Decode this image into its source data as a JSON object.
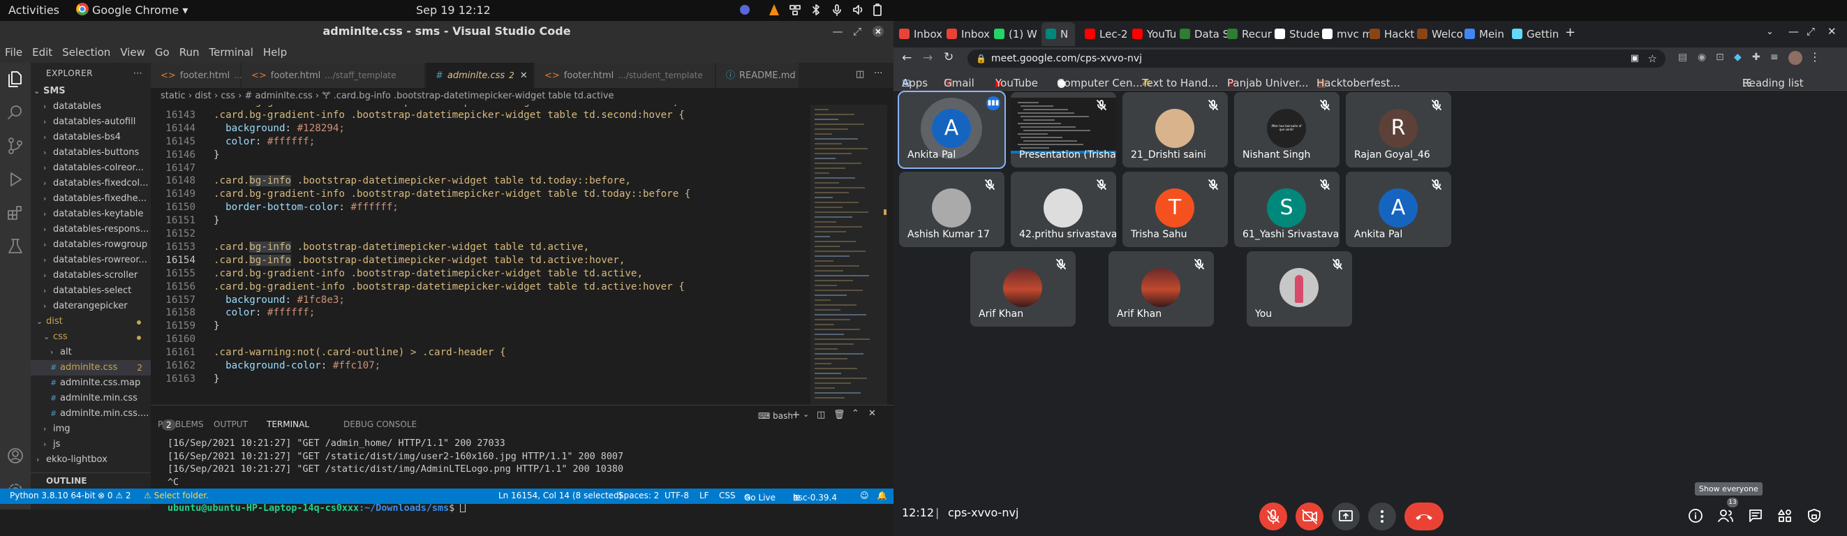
{
  "system": {
    "activities": "Activities",
    "app_menu": "Google Chrome ▾",
    "datetime": "Sep 19  12:12"
  },
  "vscode": {
    "title": "adminlte.css - sms - Visual Studio Code",
    "menu": [
      "File",
      "Edit",
      "Selection",
      "View",
      "Go",
      "Run",
      "Terminal",
      "Help"
    ],
    "explorer_header": "EXPLORER",
    "explorer_more": "···",
    "root": "SMS",
    "tree": [
      {
        "t": "datatables",
        "k": "folder",
        "d": 1
      },
      {
        "t": "datatables-autofill",
        "k": "folder",
        "d": 1
      },
      {
        "t": "datatables-bs4",
        "k": "folder",
        "d": 1
      },
      {
        "t": "datatables-buttons",
        "k": "folder",
        "d": 1
      },
      {
        "t": "datatables-colreor...",
        "k": "folder",
        "d": 1
      },
      {
        "t": "datatables-fixedcol...",
        "k": "folder",
        "d": 1
      },
      {
        "t": "datatables-fixedhe...",
        "k": "folder",
        "d": 1
      },
      {
        "t": "datatables-keytable",
        "k": "folder",
        "d": 1
      },
      {
        "t": "datatables-respons...",
        "k": "folder",
        "d": 1
      },
      {
        "t": "datatables-rowgroup",
        "k": "folder",
        "d": 1
      },
      {
        "t": "datatables-rowreor...",
        "k": "folder",
        "d": 1
      },
      {
        "t": "datatables-scroller",
        "k": "folder",
        "d": 1
      },
      {
        "t": "datatables-select",
        "k": "folder",
        "d": 1
      },
      {
        "t": "daterangepicker",
        "k": "folder",
        "d": 1
      },
      {
        "t": "dist",
        "k": "open",
        "d": 0,
        "mod": true
      },
      {
        "t": "css",
        "k": "open",
        "d": 1,
        "mod": true
      },
      {
        "t": "alt",
        "k": "folder",
        "d": 2
      },
      {
        "t": "adminlte.css",
        "k": "css",
        "d": 2,
        "badge": "2",
        "sel": true
      },
      {
        "t": "adminlte.css.map",
        "k": "css",
        "d": 2
      },
      {
        "t": "adminlte.min.css",
        "k": "css",
        "d": 2
      },
      {
        "t": "adminlte.min.css....",
        "k": "css",
        "d": 2
      },
      {
        "t": "img",
        "k": "folder",
        "d": 1
      },
      {
        "t": "js",
        "k": "folder",
        "d": 1
      },
      {
        "t": "ekko-lightbox",
        "k": "folder",
        "d": 0
      }
    ],
    "outline": "OUTLINE",
    "tabs": [
      {
        "label": "footer.html",
        "path": ".../hod_template"
      },
      {
        "label": "footer.html",
        "path": ".../staff_template"
      },
      {
        "label": "adminlte.css",
        "path": "2"
      },
      {
        "label": "footer.html",
        "path": ".../student_template"
      },
      {
        "label": "README.md",
        "path": ""
      }
    ],
    "breadcrumb": "static › dist › css › # adminlte.css › 🝖 .card.bg-info .bootstrap-datetimepicker-widget table td.active",
    "code": [
      {
        "n": "16142",
        "s": ".card.bg-gradient-info .bootstrap-datetimepicker-widget table td.second:hover,",
        "k": "sel"
      },
      {
        "n": "16143",
        "s": ".card.bg-gradient-info .bootstrap-datetimepicker-widget table td.second:hover {",
        "k": "sel"
      },
      {
        "n": "16144",
        "s": "  background: #128294;",
        "k": "prop"
      },
      {
        "n": "16145",
        "s": "  color: #ffffff;",
        "k": "prop"
      },
      {
        "n": "16146",
        "s": "}",
        "k": "pun"
      },
      {
        "n": "16147",
        "s": "",
        "k": "pun"
      },
      {
        "n": "16148",
        "s": ".card.bg-info .bootstrap-datetimepicker-widget table td.today::before,",
        "k": "sel"
      },
      {
        "n": "16149",
        "s": ".card.bg-gradient-info .bootstrap-datetimepicker-widget table td.today::before {",
        "k": "sel"
      },
      {
        "n": "16150",
        "s": "  border-bottom-color: #ffffff;",
        "k": "prop"
      },
      {
        "n": "16151",
        "s": "}",
        "k": "pun"
      },
      {
        "n": "16152",
        "s": "",
        "k": "pun"
      },
      {
        "n": "16153",
        "s": ".card.bg-info .bootstrap-datetimepicker-widget table td.active,",
        "k": "sel"
      },
      {
        "n": "16154",
        "s": ".card.bg-info .bootstrap-datetimepicker-widget table td.active:hover,",
        "k": "sel",
        "cur": true
      },
      {
        "n": "16155",
        "s": ".card.bg-gradient-info .bootstrap-datetimepicker-widget table td.active,",
        "k": "sel"
      },
      {
        "n": "16156",
        "s": ".card.bg-gradient-info .bootstrap-datetimepicker-widget table td.active:hover {",
        "k": "sel"
      },
      {
        "n": "16157",
        "s": "  background: #1fc8e3;",
        "k": "prop"
      },
      {
        "n": "16158",
        "s": "  color: #ffffff;",
        "k": "prop"
      },
      {
        "n": "16159",
        "s": "}",
        "k": "pun"
      },
      {
        "n": "16160",
        "s": "",
        "k": "pun"
      },
      {
        "n": "16161",
        "s": ".card-warning:not(.card-outline) > .card-header {",
        "k": "sel"
      },
      {
        "n": "16162",
        "s": "  background-color: #ffc107;",
        "k": "prop"
      },
      {
        "n": "16163",
        "s": "}",
        "k": "pun"
      }
    ],
    "panel_tabs": [
      "PROBLEMS",
      "OUTPUT",
      "TERMINAL",
      "DEBUG CONSOLE"
    ],
    "problems_count": "2",
    "shell": "bash",
    "terminal": [
      "[16/Sep/2021 10:21:27] \"GET /admin_home/ HTTP/1.1\" 200 27033",
      "[16/Sep/2021 10:21:27] \"GET /static/dist/img/user2-160x160.jpg HTTP/1.1\" 200 8007",
      "[16/Sep/2021 10:21:27] \"GET /static/dist/img/AdminLTELogo.png HTTP/1.1\" 200 10380",
      "^C"
    ],
    "prompt_user": "ubuntu@ubuntu-HP-Laptop-14q-cs0xxx",
    "prompt_path": ":~/Downloads/sms",
    "prompt_end": "$ ",
    "status": {
      "python": "Python 3.8.10 64-bit",
      "problems": "⊗ 0 ⚠ 2",
      "warning": "⚠ Select folder.",
      "position": "Ln 16154, Col 14 (8 selected)",
      "spaces": "Spaces: 2",
      "encoding": "UTF-8",
      "eol": "LF",
      "lang": "CSS",
      "golive": "Go Live",
      "bsc": "bsc-0.39.4"
    }
  },
  "chrome": {
    "tabs": [
      {
        "label": "Inbox",
        "color": "#ea4335"
      },
      {
        "label": "Inbox",
        "color": "#ea4335"
      },
      {
        "label": "(1) W",
        "color": "#25d366"
      },
      {
        "label": "N",
        "color": "#00897b"
      },
      {
        "label": "Lec-2",
        "color": "#ff0000"
      },
      {
        "label": "YouTu",
        "color": "#ff0000"
      },
      {
        "label": "Data S",
        "color": "#2e7d32"
      },
      {
        "label": "Recur",
        "color": "#2e7d32"
      },
      {
        "label": "Stude",
        "color": "#ffffff"
      },
      {
        "label": "mvc m",
        "color": "#ffffff"
      },
      {
        "label": "Hackt",
        "color": "#8b4513"
      },
      {
        "label": "Welco",
        "color": "#8b4513"
      },
      {
        "label": "Mein",
        "color": "#4285f4"
      },
      {
        "label": "Gettin",
        "color": "#61dafb"
      }
    ],
    "url": "meet.google.com/cps-xvvo-nvj",
    "bookmarks": [
      "Apps",
      "Gmail",
      "YouTube",
      "Computer Cen...",
      "Text to Hand...",
      "Panjab Univer...",
      "Hacktoberfest..."
    ],
    "reading_list": "Reading list",
    "meet": {
      "participants": [
        {
          "name": "Ankita Pal",
          "type": "letter",
          "letter": "A",
          "color": "#1565c0",
          "speaking": true
        },
        {
          "name": "Presentation (Trisha Sahu)",
          "type": "screen"
        },
        {
          "name": "21_Drishti saini",
          "type": "photo",
          "color": "#d9b38c"
        },
        {
          "name": "Nishant Singh",
          "type": "photo",
          "color": "#222"
        },
        {
          "name": "Rajan Goyal_46",
          "type": "letter",
          "letter": "R",
          "color": "#5d4037"
        },
        {
          "name": "Ashish Kumar 17",
          "type": "photo",
          "color": "#aaa"
        },
        {
          "name": "42.prithu srivastava",
          "type": "photo",
          "color": "#ddd"
        },
        {
          "name": "Trisha Sahu",
          "type": "letter",
          "letter": "T",
          "color": "#f4511e"
        },
        {
          "name": "61_Yashi Srivastava",
          "type": "letter",
          "letter": "S",
          "color": "#00897b"
        },
        {
          "name": "Ankita Pal",
          "type": "letter",
          "letter": "A",
          "color": "#1565c0"
        },
        {
          "name": "Arif Khan",
          "type": "photo",
          "color": "#b0453a"
        },
        {
          "name": "Arif Khan",
          "type": "photo",
          "color": "#b0453a"
        },
        {
          "name": "You",
          "type": "photo",
          "color": "#c7c7c7"
        }
      ],
      "time": "12:12",
      "code": "cps-xvvo-nvj",
      "tooltip": "Show everyone",
      "people_count": "13",
      "nishant_caption": "Áfter hue bainsaite of que sontir"
    }
  }
}
